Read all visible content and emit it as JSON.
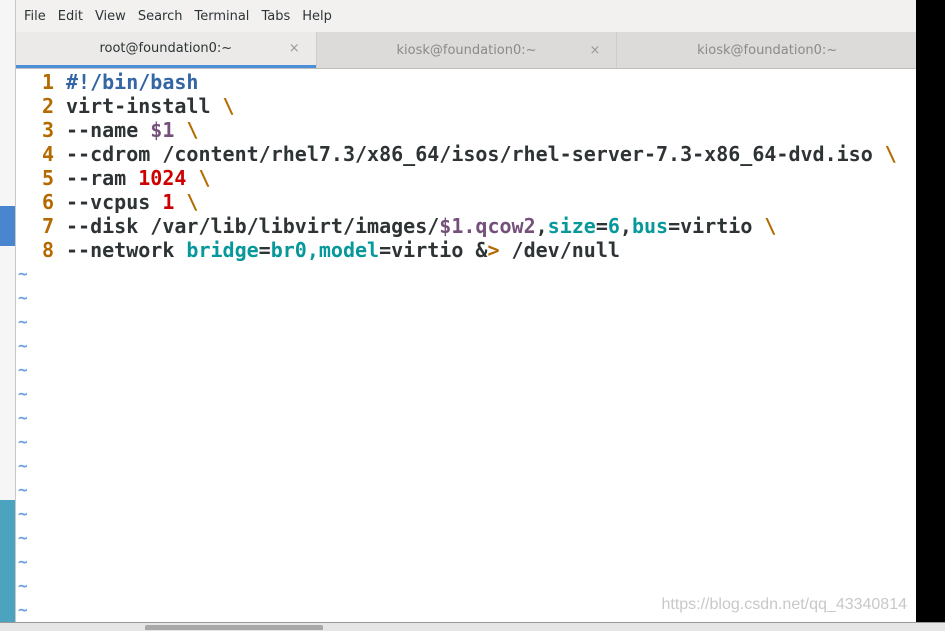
{
  "menu": [
    "File",
    "Edit",
    "View",
    "Search",
    "Terminal",
    "Tabs",
    "Help"
  ],
  "tabs": [
    {
      "label": "root@foundation0:~",
      "active": true,
      "close": "×"
    },
    {
      "label": "kiosk@foundation0:~",
      "active": false,
      "close": "×"
    },
    {
      "label": "kiosk@foundation0:~",
      "active": false
    }
  ],
  "lines": [
    [
      [
        "#!/bin/bash",
        "blue"
      ]
    ],
    [
      [
        "virt-install ",
        ""
      ],
      [
        "\\",
        "or"
      ]
    ],
    [
      [
        "--name ",
        ""
      ],
      [
        "$1",
        "pur"
      ],
      [
        " ",
        ""
      ],
      [
        "\\",
        "or"
      ]
    ],
    [
      [
        "--cdrom /content/rhel7.3/x86_64/isos/rhel-server-7.3-x86_64-dvd.iso ",
        ""
      ],
      [
        "\\",
        "or"
      ]
    ],
    [
      [
        "--ram ",
        ""
      ],
      [
        "1024",
        "red"
      ],
      [
        " ",
        ""
      ],
      [
        "\\",
        "or"
      ]
    ],
    [
      [
        "--vcpus ",
        ""
      ],
      [
        "1",
        "red"
      ],
      [
        " ",
        ""
      ],
      [
        "\\",
        "or"
      ]
    ],
    [
      [
        "--disk /var/lib/libvirt/images/",
        ""
      ],
      [
        "$1.qcow2",
        "pur"
      ],
      [
        ",",
        ""
      ],
      [
        "size",
        "teal"
      ],
      [
        "=",
        ""
      ],
      [
        "6",
        "teal"
      ],
      [
        ",",
        ""
      ],
      [
        "bus",
        "teal"
      ],
      [
        "=virtio ",
        ""
      ],
      [
        "\\",
        "or"
      ]
    ],
    [
      [
        "--network ",
        ""
      ],
      [
        "bridge",
        "teal"
      ],
      [
        "=",
        ""
      ],
      [
        "br0,model",
        "teal"
      ],
      [
        "=virtio &",
        ""
      ],
      [
        ">",
        "or"
      ],
      [
        " /dev/null",
        ""
      ]
    ]
  ],
  "tilde": "~",
  "tilde_count": 15,
  "watermark": "https://blog.csdn.net/qq_43340814",
  "colors": {
    "linenum": "#b36a00",
    "accent": "#4a90d9"
  }
}
